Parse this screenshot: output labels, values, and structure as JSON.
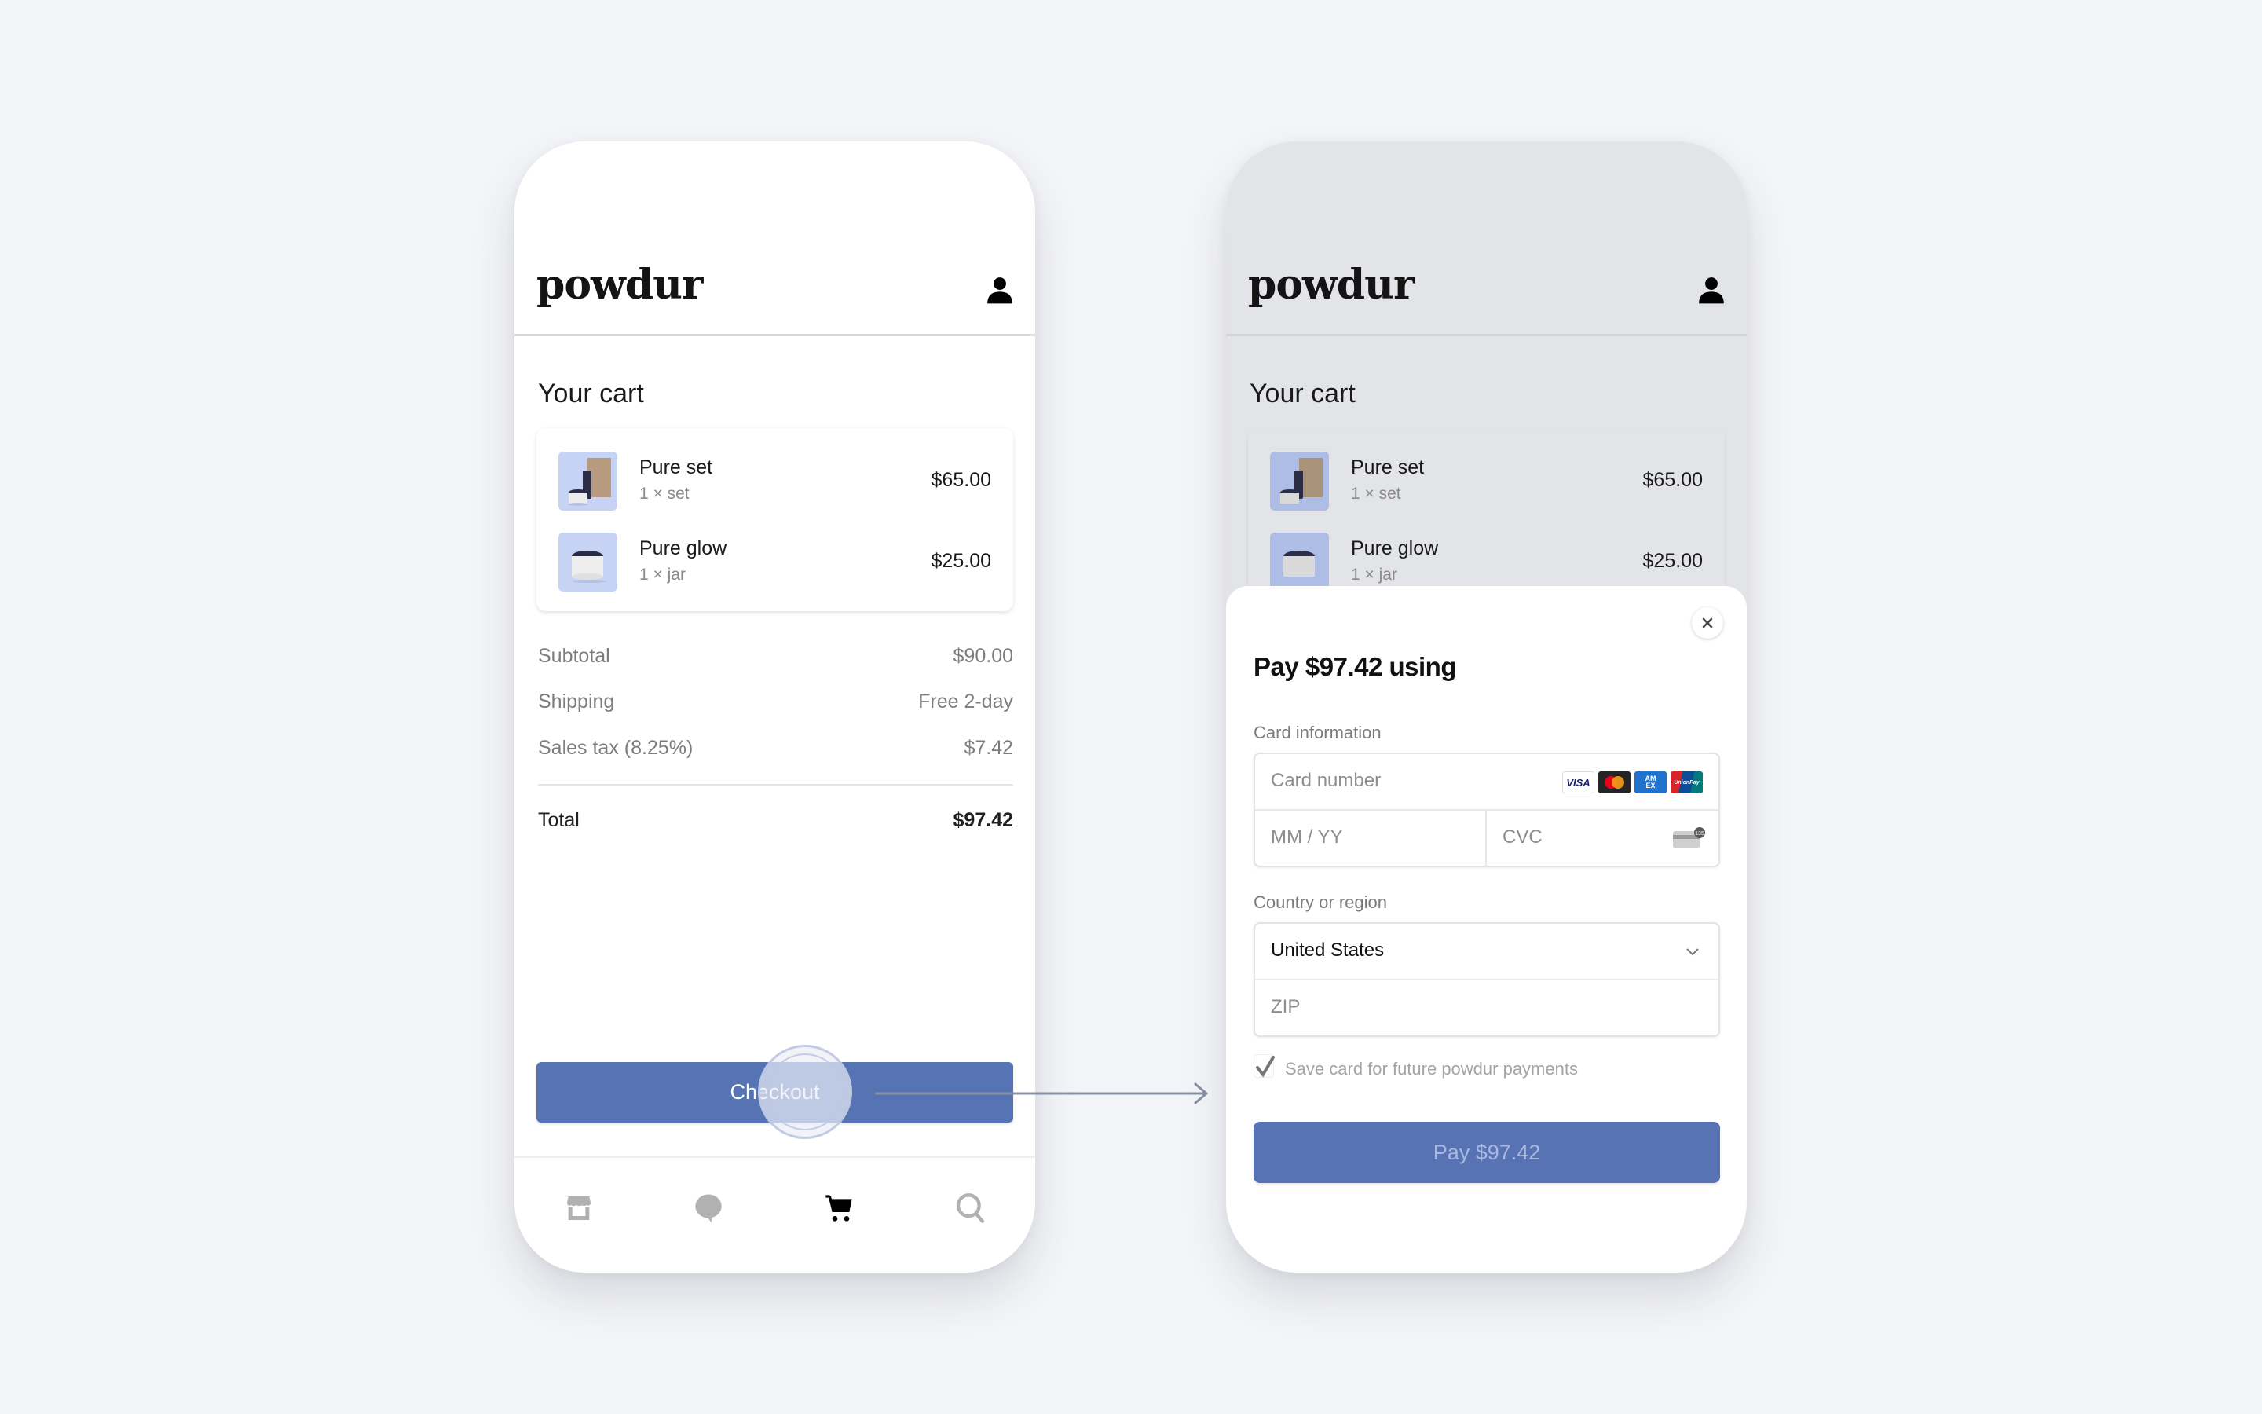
{
  "brand": {
    "logo": "powdur"
  },
  "colors": {
    "accent": "#5674b4",
    "background": "#f4f5f8",
    "overlay": "#e3e4e7",
    "thumb_bg": "#c6d3f5"
  },
  "cart": {
    "title": "Your cart",
    "items": [
      {
        "name": "Pure set",
        "qty": "1 × set",
        "price": "$65.00",
        "image": "pure-set-product-image"
      },
      {
        "name": "Pure glow",
        "qty": "1 × jar",
        "price": "$25.00",
        "image": "pure-glow-product-image"
      }
    ],
    "summary": [
      {
        "label": "Subtotal",
        "value": "$90.00"
      },
      {
        "label": "Shipping",
        "value": "Free 2-day"
      },
      {
        "label": "Sales tax (8.25%)",
        "value": "$7.42"
      }
    ],
    "total": {
      "label": "Total",
      "value": "$97.42"
    },
    "checkout_label": "Checkout"
  },
  "nav": {
    "items": [
      {
        "name": "shop",
        "icon": "storefront-icon",
        "active": false
      },
      {
        "name": "chat",
        "icon": "chat-bubble-icon",
        "active": false
      },
      {
        "name": "cart",
        "icon": "cart-icon",
        "active": true
      },
      {
        "name": "search",
        "icon": "search-icon",
        "active": false
      }
    ]
  },
  "payment": {
    "title": "Pay $97.42 using",
    "card_label": "Card information",
    "card_number_placeholder": "Card number",
    "expiry_placeholder": "MM / YY",
    "cvc_placeholder": "CVC",
    "card_brands": [
      "VISA",
      "Mastercard",
      "AMEX",
      "UnionPay"
    ],
    "cvc_hint": "135",
    "country_label": "Country or region",
    "country_value": "United States",
    "zip_placeholder": "ZIP",
    "save_card_label": "Save card for future powdur payments",
    "save_card_checked": true,
    "pay_label": "Pay $97.42"
  }
}
